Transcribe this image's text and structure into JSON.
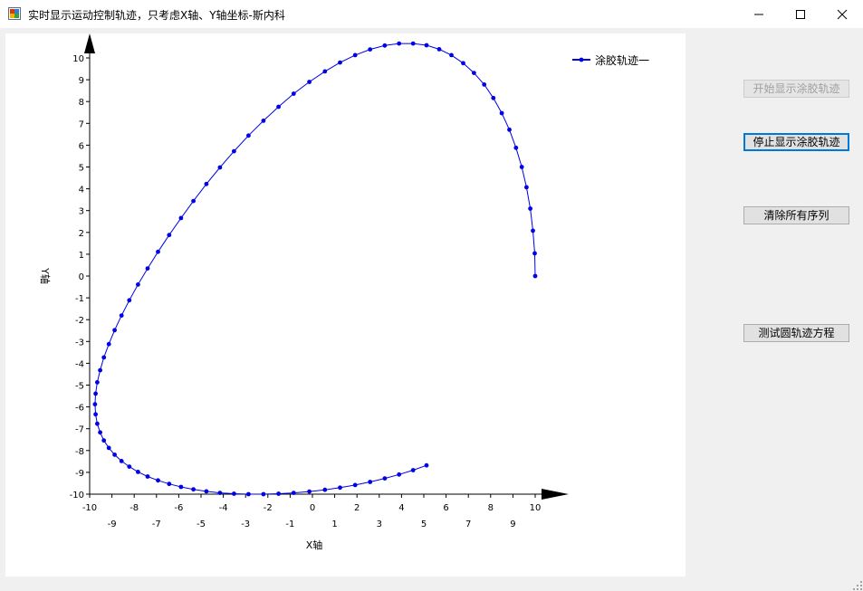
{
  "window": {
    "title": "实时显示运动控制轨迹，只考虑X轴、Y轴坐标-斯内科"
  },
  "buttons": {
    "start": "开始显示涂胶轨迹",
    "stop": "停止显示涂胶轨迹",
    "clear": "清除所有序列",
    "test": "测试圆轨迹方程"
  },
  "colors": {
    "series": "#0000e6",
    "focus_border": "#0078d7"
  },
  "chart_data": {
    "type": "line",
    "xlabel": "X轴",
    "ylabel": "Y轴",
    "xlim": [
      -10,
      10
    ],
    "ylim": [
      -10,
      10
    ],
    "x_ticks_top_row": [
      "-10",
      "-8",
      "-6",
      "-4",
      "-2",
      "0",
      "2",
      "4",
      "6",
      "8",
      "10"
    ],
    "x_ticks_bottom_row": [
      "-9",
      "-7",
      "-5",
      "-3",
      "-1",
      "1",
      "3",
      "5",
      "7",
      "9"
    ],
    "y_ticks": [
      "10",
      "9",
      "8",
      "7",
      "6",
      "5",
      "4",
      "3",
      "2",
      "1",
      "0",
      "-1",
      "-2",
      "-3",
      "-4",
      "-5",
      "-6",
      "-7",
      "-8",
      "-9",
      "-10"
    ],
    "grid": false,
    "legend": "top-right",
    "series": [
      {
        "name": "涂胶轨迹一",
        "x": [
          10,
          9.98,
          9.9,
          9.78,
          9.61,
          9.4,
          9.14,
          8.84,
          8.5,
          8.12,
          7.71,
          7.25,
          6.77,
          6.24,
          5.69,
          5.12,
          4.52,
          3.89,
          3.25,
          2.59,
          1.92,
          1.24,
          0.56,
          -0.14,
          -0.84,
          -1.52,
          -2.2,
          -2.87,
          -3.52,
          -4.15,
          -4.76,
          -5.34,
          -5.9,
          -6.43,
          -6.93,
          -7.4,
          -7.83,
          -8.22,
          -8.57,
          -8.88,
          -9.14,
          -9.36,
          -9.53,
          -9.66,
          -9.73,
          -9.76,
          -9.73,
          -9.66,
          -9.53,
          -9.36,
          -9.14,
          -8.88,
          -8.57,
          -8.22,
          -7.83,
          -7.4,
          -6.93,
          -6.43,
          -5.9,
          -5.34,
          -4.76,
          -4.15,
          -3.52,
          -2.87,
          -2.2,
          -1.52,
          -0.84,
          -0.14,
          0.56,
          1.24,
          1.92,
          2.59,
          3.25,
          3.89,
          4.52,
          5.12
        ],
        "y": [
          0,
          1.04,
          2.08,
          3.09,
          4.07,
          5.0,
          5.88,
          6.71,
          7.47,
          8.16,
          8.78,
          9.31,
          9.76,
          10.13,
          10.4,
          10.58,
          10.66,
          10.66,
          10.57,
          10.39,
          10.13,
          9.79,
          9.38,
          8.9,
          8.36,
          7.76,
          7.12,
          6.44,
          5.72,
          4.98,
          4.22,
          3.44,
          2.66,
          1.88,
          1.11,
          0.35,
          -0.39,
          -1.11,
          -1.81,
          -2.48,
          -3.12,
          -3.73,
          -4.32,
          -4.87,
          -5.39,
          -5.88,
          -6.34,
          -6.77,
          -7.17,
          -7.54,
          -7.88,
          -8.19,
          -8.48,
          -8.74,
          -8.98,
          -9.19,
          -9.37,
          -9.53,
          -9.67,
          -9.78,
          -9.87,
          -9.94,
          -9.98,
          -10.0,
          -10.0,
          -9.98,
          -9.94,
          -9.88,
          -9.8,
          -9.7,
          -9.58,
          -9.44,
          -9.28,
          -9.1,
          -8.9,
          -8.68
        ]
      }
    ]
  }
}
